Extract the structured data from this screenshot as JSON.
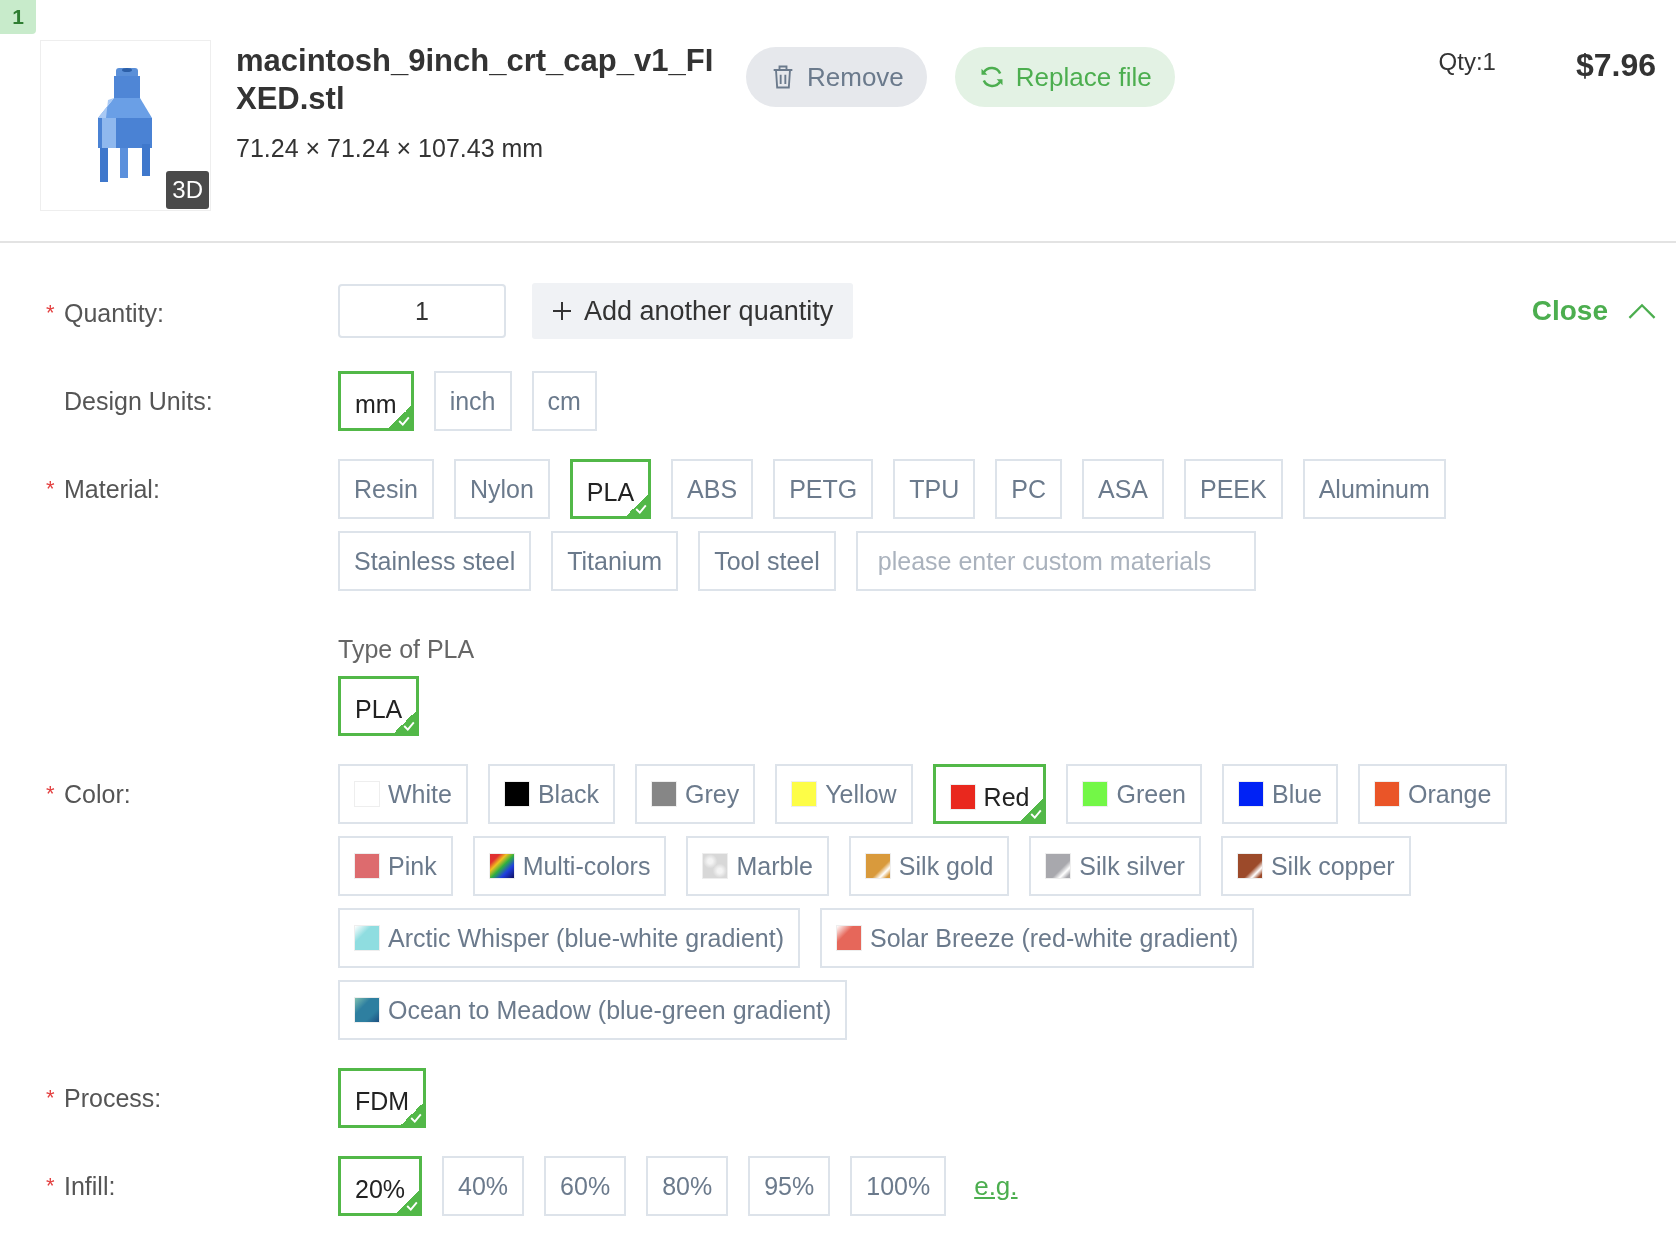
{
  "item_number": "1",
  "file": {
    "name": "macintosh_9inch_crt_cap_v1_FIXED.stl",
    "dimensions": "71.24 × 71.24 × 107.43 mm",
    "view_badge": "3D"
  },
  "actions": [
    {
      "kind": "remove",
      "label": "Remove"
    },
    {
      "kind": "replace",
      "label": "Replace file"
    }
  ],
  "qty_summary": "Qty:1",
  "price": "$7.96",
  "quantity": {
    "label": "Quantity:",
    "required_mark": "*",
    "value": "1",
    "add_label": "Add another quantity"
  },
  "close_label": "Close",
  "design_units": {
    "label": "Design Units:",
    "options": [
      {
        "label": "mm",
        "selected": true
      },
      {
        "label": "inch",
        "selected": false
      },
      {
        "label": "cm",
        "selected": false
      }
    ]
  },
  "material": {
    "label": "Material:",
    "required_mark": "*",
    "options": [
      {
        "label": "Resin",
        "selected": false
      },
      {
        "label": "Nylon",
        "selected": false
      },
      {
        "label": "PLA",
        "selected": true
      },
      {
        "label": "ABS",
        "selected": false
      },
      {
        "label": "PETG",
        "selected": false
      },
      {
        "label": "TPU",
        "selected": false
      },
      {
        "label": "PC",
        "selected": false
      },
      {
        "label": "ASA",
        "selected": false
      },
      {
        "label": "PEEK",
        "selected": false
      },
      {
        "label": "Aluminum",
        "selected": false
      },
      {
        "label": "Stainless steel",
        "selected": false
      },
      {
        "label": "Titanium",
        "selected": false
      },
      {
        "label": "Tool steel",
        "selected": false
      }
    ],
    "custom_placeholder": "please enter custom materials"
  },
  "material_type": {
    "label": "Type of PLA",
    "options": [
      {
        "label": "PLA",
        "selected": true
      }
    ]
  },
  "color": {
    "label": "Color:",
    "required_mark": "*",
    "options": [
      {
        "label": "White",
        "selected": false,
        "kind": "solid",
        "color": "#ffffff"
      },
      {
        "label": "Black",
        "selected": false,
        "kind": "solid",
        "color": "#000000"
      },
      {
        "label": "Grey",
        "selected": false,
        "kind": "solid",
        "color": "#868686"
      },
      {
        "label": "Yellow",
        "selected": false,
        "kind": "solid",
        "color": "#fdfd47"
      },
      {
        "label": "Red",
        "selected": true,
        "kind": "solid",
        "color": "#e9281e"
      },
      {
        "label": "Green",
        "selected": false,
        "kind": "solid",
        "color": "#73f747"
      },
      {
        "label": "Blue",
        "selected": false,
        "kind": "solid",
        "color": "#0022f5"
      },
      {
        "label": "Orange",
        "selected": false,
        "kind": "solid",
        "color": "#ea5528"
      },
      {
        "label": "Pink",
        "selected": false,
        "kind": "solid",
        "color": "#dd6b6e"
      },
      {
        "label": "Multi-colors",
        "selected": false,
        "kind": "rainbow"
      },
      {
        "label": "Marble",
        "selected": false,
        "kind": "speckle",
        "color": "#d8d8d8"
      },
      {
        "label": "Silk gold",
        "selected": false,
        "kind": "metallic",
        "color": "#d99a3c"
      },
      {
        "label": "Silk silver",
        "selected": false,
        "kind": "metallic",
        "color": "#a8a8ad"
      },
      {
        "label": "Silk copper",
        "selected": false,
        "kind": "metallic",
        "color": "#9c4a2a"
      },
      {
        "label": "Arctic Whisper (blue-white gradient)",
        "selected": false,
        "kind": "fade",
        "color": "#8fdde0"
      },
      {
        "label": "Solar Breeze (red-white gradient)",
        "selected": false,
        "kind": "fade",
        "color": "#e6675a"
      },
      {
        "label": "Ocean to Meadow (blue-green gradient)",
        "selected": false,
        "kind": "blend",
        "color": "#2e7fa0"
      }
    ]
  },
  "process": {
    "label": "Process:",
    "required_mark": "*",
    "options": [
      {
        "label": "FDM",
        "selected": true
      }
    ]
  },
  "infill": {
    "label": "Infill:",
    "required_mark": "*",
    "options": [
      {
        "label": "20%",
        "selected": true
      },
      {
        "label": "40%",
        "selected": false
      },
      {
        "label": "60%",
        "selected": false
      },
      {
        "label": "80%",
        "selected": false
      },
      {
        "label": "95%",
        "selected": false
      },
      {
        "label": "100%",
        "selected": false
      }
    ],
    "example_link": "e.g."
  }
}
